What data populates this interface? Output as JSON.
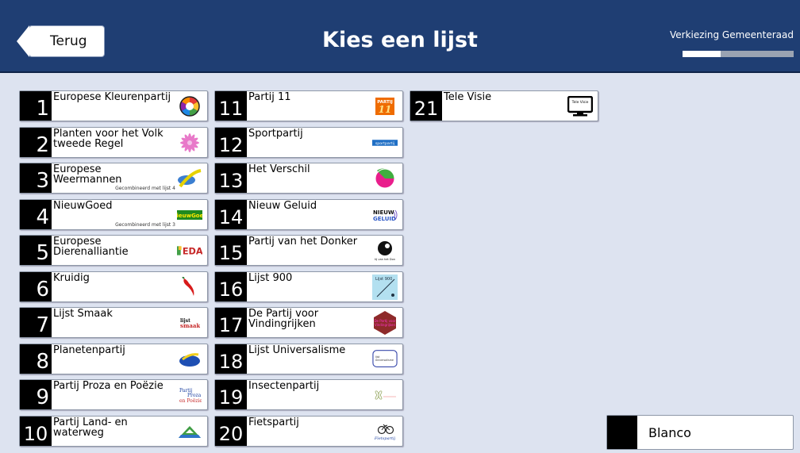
{
  "header": {
    "back_label": "Terug",
    "title": "Kies een lijst",
    "subtitle": "Verkiezing Gemeenteraad"
  },
  "progress": {
    "steps": 3,
    "completed": 1
  },
  "colors": {
    "header_bg": "#1f3e73",
    "page_bg": "#dde3f0",
    "progress_done": "#ffffff",
    "progress_todo": "#9aa3b2"
  },
  "lists": [
    {
      "number": "1",
      "name": "Europese Kleurenpartij",
      "note": "",
      "icon": "color-wheel-logo"
    },
    {
      "number": "2",
      "name": "Planten voor het Volk tweede Regel",
      "note": "",
      "icon": "flower-logo"
    },
    {
      "number": "3",
      "name": "Europese Weermannen",
      "note": "Gecombineerd met lijst 4",
      "icon": "weather-logo"
    },
    {
      "number": "4",
      "name": "NieuwGoed",
      "note": "Gecombineerd met lijst 3",
      "icon": "nieuwgoed-logo",
      "logo_text": "NieuwGoed"
    },
    {
      "number": "5",
      "name": "Europese Dierenalliantie",
      "note": "",
      "icon": "eda-logo",
      "logo_text": "EDA"
    },
    {
      "number": "6",
      "name": "Kruidig",
      "note": "",
      "icon": "chili-logo"
    },
    {
      "number": "7",
      "name": "Lijst Smaak",
      "note": "",
      "icon": "lijst-smaak-logo",
      "logo_text": "lijst smaak"
    },
    {
      "number": "8",
      "name": "Planetenpartij",
      "note": "",
      "icon": "planet-logo"
    },
    {
      "number": "9",
      "name": "Partij Proza en Poëzie",
      "note": "",
      "icon": "proza-poezie-logo",
      "logo_text": "Partij Proza en Poëzie"
    },
    {
      "number": "10",
      "name": "Partij Land- en waterweg",
      "note": "",
      "icon": "land-water-logo"
    },
    {
      "number": "11",
      "name": "Partij 11",
      "note": "",
      "icon": "partij-11-logo",
      "logo_text": "PARTIJ 11"
    },
    {
      "number": "12",
      "name": "Sportpartij",
      "note": "",
      "icon": "sportpartij-logo",
      "logo_text": "sportpartij"
    },
    {
      "number": "13",
      "name": "Het Verschil",
      "note": "",
      "icon": "het-verschil-logo"
    },
    {
      "number": "14",
      "name": "Nieuw Geluid",
      "note": "",
      "icon": "nieuw-geluid-logo",
      "logo_text": "NIEUW GELUID"
    },
    {
      "number": "15",
      "name": "Partij van het Donker",
      "note": "",
      "icon": "donker-logo",
      "logo_text": "Partij van het Donker"
    },
    {
      "number": "16",
      "name": "Lijst 900",
      "note": "",
      "icon": "lijst-900-logo",
      "logo_text": "Lijst 900"
    },
    {
      "number": "17",
      "name": "De Partij voor Vindingrijken",
      "note": "",
      "icon": "vindingrijken-logo",
      "logo_text": "De Partij voor Vindingrijken"
    },
    {
      "number": "18",
      "name": "Lijst Universalisme",
      "note": "",
      "icon": "universalisme-logo",
      "logo_text": "lijst Universalisme"
    },
    {
      "number": "19",
      "name": "Insectenpartij",
      "note": "",
      "icon": "insect-logo"
    },
    {
      "number": "20",
      "name": "Fietspartij",
      "note": "",
      "icon": "bicycle-logo",
      "logo_text": "Fietspartij"
    },
    {
      "number": "21",
      "name": "Tele Visie",
      "note": "",
      "icon": "tv-logo",
      "logo_text": "Tele Visie"
    }
  ],
  "blanco_label": "Blanco"
}
